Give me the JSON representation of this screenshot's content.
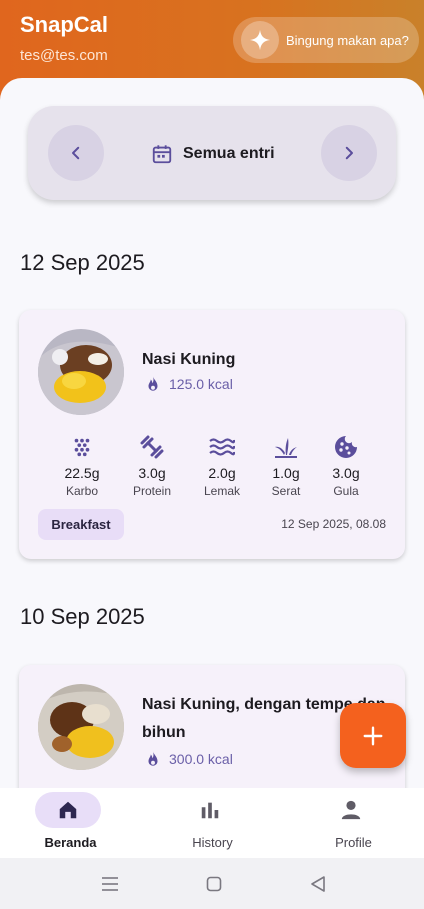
{
  "header": {
    "app_title": "SnapCal",
    "user_email": "tes@tes.com",
    "ai_suggestion_label": "Bingung makan apa?",
    "ai_icon": "sparkle-icon"
  },
  "filter": {
    "label": "Semua entri",
    "icon": "calendar-icon",
    "prev_icon": "chevron-left-icon",
    "next_icon": "chevron-right-icon"
  },
  "groups": [
    {
      "date": "12 Sep 2025",
      "entries": [
        {
          "name": "Nasi Kuning",
          "kcal": "125.0 kcal",
          "meal_type": "Breakfast",
          "timestamp": "12 Sep 2025, 08.08",
          "nutrients": [
            {
              "amount": "22.5g",
              "label": "Karbo",
              "icon": "grain-icon"
            },
            {
              "amount": "3.0g",
              "label": "Protein",
              "icon": "dumbbell-icon"
            },
            {
              "amount": "2.0g",
              "label": "Lemak",
              "icon": "waves-icon"
            },
            {
              "amount": "1.0g",
              "label": "Serat",
              "icon": "grass-icon"
            },
            {
              "amount": "3.0g",
              "label": "Gula",
              "icon": "cookie-icon"
            }
          ]
        }
      ]
    },
    {
      "date": "10 Sep 2025",
      "entries": [
        {
          "name": "Nasi Kuning, dengan tempe dan bihun",
          "kcal": "300.0 kcal"
        }
      ]
    }
  ],
  "bottom_nav": [
    {
      "label": "Beranda",
      "icon": "home-icon",
      "active": true
    },
    {
      "label": "History",
      "icon": "bar-chart-icon",
      "active": false
    },
    {
      "label": "Profile",
      "icon": "person-icon",
      "active": false
    }
  ],
  "colors": {
    "header_orange": "#e0661e",
    "accent_purple": "#6a5fa8",
    "fab_orange": "#f4611e",
    "card_bg": "#f6f1fa"
  }
}
